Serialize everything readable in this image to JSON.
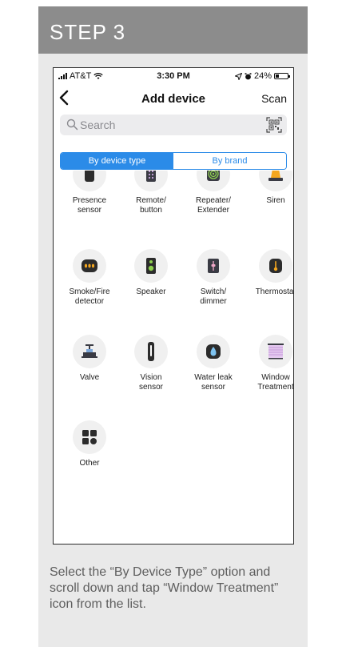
{
  "step": {
    "title": "STEP 3"
  },
  "status_bar": {
    "carrier": "AT&T",
    "time": "3:30 PM",
    "battery": "24%"
  },
  "nav": {
    "back_icon": "chevron-left-icon",
    "title": "Add device",
    "scan_label": "Scan"
  },
  "search": {
    "placeholder": "Search"
  },
  "segment": {
    "by_type": "By device type",
    "by_brand": "By brand",
    "active_color": "#2b8be8"
  },
  "devices": [
    {
      "label1": "Presence",
      "label2": "sensor",
      "icon": "presence-sensor-icon"
    },
    {
      "label1": "Remote/",
      "label2": "button",
      "icon": "remote-button-icon"
    },
    {
      "label1": "Repeater/",
      "label2": "Extender",
      "icon": "repeater-icon"
    },
    {
      "label1": "Siren",
      "label2": "",
      "icon": "siren-icon"
    },
    {
      "label1": "Smoke/Fire",
      "label2": "detector",
      "icon": "smoke-detector-icon"
    },
    {
      "label1": "Speaker",
      "label2": "",
      "icon": "speaker-icon"
    },
    {
      "label1": "Switch/",
      "label2": "dimmer",
      "icon": "switch-icon"
    },
    {
      "label1": "Thermostat",
      "label2": "",
      "icon": "thermostat-icon"
    },
    {
      "label1": "Valve",
      "label2": "",
      "icon": "valve-icon"
    },
    {
      "label1": "Vision",
      "label2": "sensor",
      "icon": "vision-sensor-icon"
    },
    {
      "label1": "Water leak",
      "label2": "sensor",
      "icon": "water-leak-icon"
    },
    {
      "label1": "Window",
      "label2": "Treatment",
      "icon": "window-treatment-icon"
    },
    {
      "label1": "Other",
      "label2": "",
      "icon": "other-icon"
    }
  ],
  "caption": "Select the “By Device Type” option and scroll down and tap “Window Treatment” icon from the list."
}
